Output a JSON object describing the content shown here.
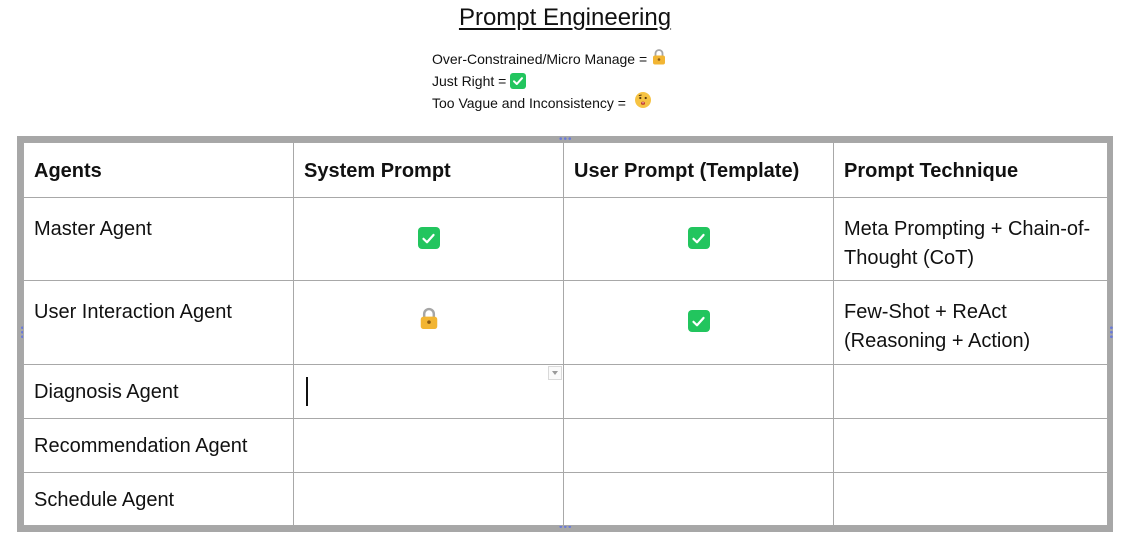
{
  "document": {
    "title": "Prompt Engineering",
    "legend": [
      {
        "label": "Over-Constrained/Micro Manage = ",
        "icon": "lock-icon"
      },
      {
        "label": "Just Right = ",
        "icon": "check-icon"
      },
      {
        "label": "Too Vague and Inconsistency = ",
        "icon": "thinking-face-icon"
      }
    ]
  },
  "table": {
    "headers": [
      "Agents",
      "System Prompt",
      "User Prompt (Template)",
      "Prompt Technique"
    ],
    "rows": [
      {
        "agent": "Master Agent",
        "system_icon": "check-icon",
        "user_icon": "check-icon",
        "technique": "Meta Prompting + Chain-of-Thought (CoT)"
      },
      {
        "agent": "User Interaction Agent",
        "system_icon": "lock-icon",
        "user_icon": "check-icon",
        "technique": "Few-Shot + ReAct (Reasoning + Action)"
      },
      {
        "agent": "Diagnosis Agent",
        "system_icon": "",
        "user_icon": "",
        "technique": ""
      },
      {
        "agent": "Recommendation Agent",
        "system_icon": "",
        "user_icon": "",
        "technique": ""
      },
      {
        "agent": "Schedule Agent",
        "system_icon": "",
        "user_icon": "",
        "technique": ""
      }
    ]
  },
  "colors": {
    "check": "#22c55e",
    "lock": "#f2b533",
    "frame": "#a7a7a7",
    "handle": "#6b7bd8"
  }
}
